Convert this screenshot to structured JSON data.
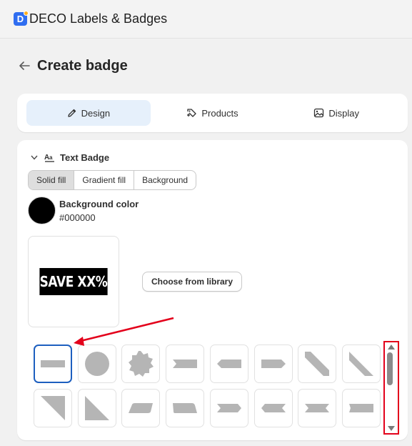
{
  "app": {
    "logo_letter": "D",
    "title": "DECO Labels & Badges"
  },
  "page": {
    "back_icon": "arrow-left-icon",
    "title": "Create badge"
  },
  "tabs": [
    {
      "label": "Design",
      "icon": "pencil-icon",
      "active": true
    },
    {
      "label": "Products",
      "icon": "tag-plus-icon",
      "active": false
    },
    {
      "label": "Display",
      "icon": "image-icon",
      "active": false
    }
  ],
  "section": {
    "title": "Text Badge",
    "icon": "text-style-icon"
  },
  "fill_modes": [
    {
      "label": "Solid fill",
      "active": true
    },
    {
      "label": "Gradient fill",
      "active": false
    },
    {
      "label": "Background",
      "active": false
    }
  ],
  "background_color": {
    "label": "Background color",
    "hex": "#000000"
  },
  "preview": {
    "text": "SAVE XX%",
    "bg_color": "#000000",
    "text_color": "#ffffff"
  },
  "library_button": "Choose from library",
  "shapes": [
    "rectangle",
    "circle",
    "starburst",
    "notched-left-banner",
    "pointed-left-tag",
    "pointed-right-tag",
    "diagonal-strip-down",
    "corner-ribbon-right",
    "triangle-top-right",
    "triangle-bottom-left",
    "slanted-tab-left",
    "slanted-tab-right",
    "chevron-band-right",
    "chevron-band-left",
    "double-notched-banner",
    "notched-ribbon"
  ],
  "selected_shape": "rectangle",
  "colors": {
    "accent": "#1d5fbf",
    "annotation": "#e3001b",
    "shape_fill": "#b5b5b5",
    "tab_active": "#e6f0fb"
  }
}
